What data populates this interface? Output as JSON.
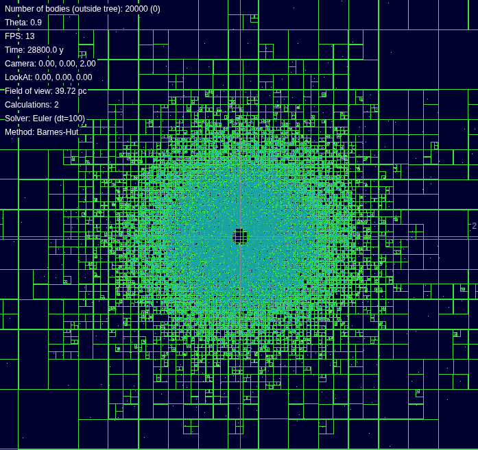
{
  "hud": {
    "lines": [
      "Number of bodies (outside tree): 20000 (0)",
      "Theta: 0.9",
      "FPS: 13",
      "Time: 28800.0 y",
      "Camera: 0.00, 0.00, 2.00",
      "LookAt: 0.00, 0.00, 0.00",
      "Field of view: 39.72 pc",
      "Calculations: 2",
      "Solver: Euler (dt=100)",
      "Method: Barnes-Hut"
    ]
  },
  "axis_label": "2"
}
